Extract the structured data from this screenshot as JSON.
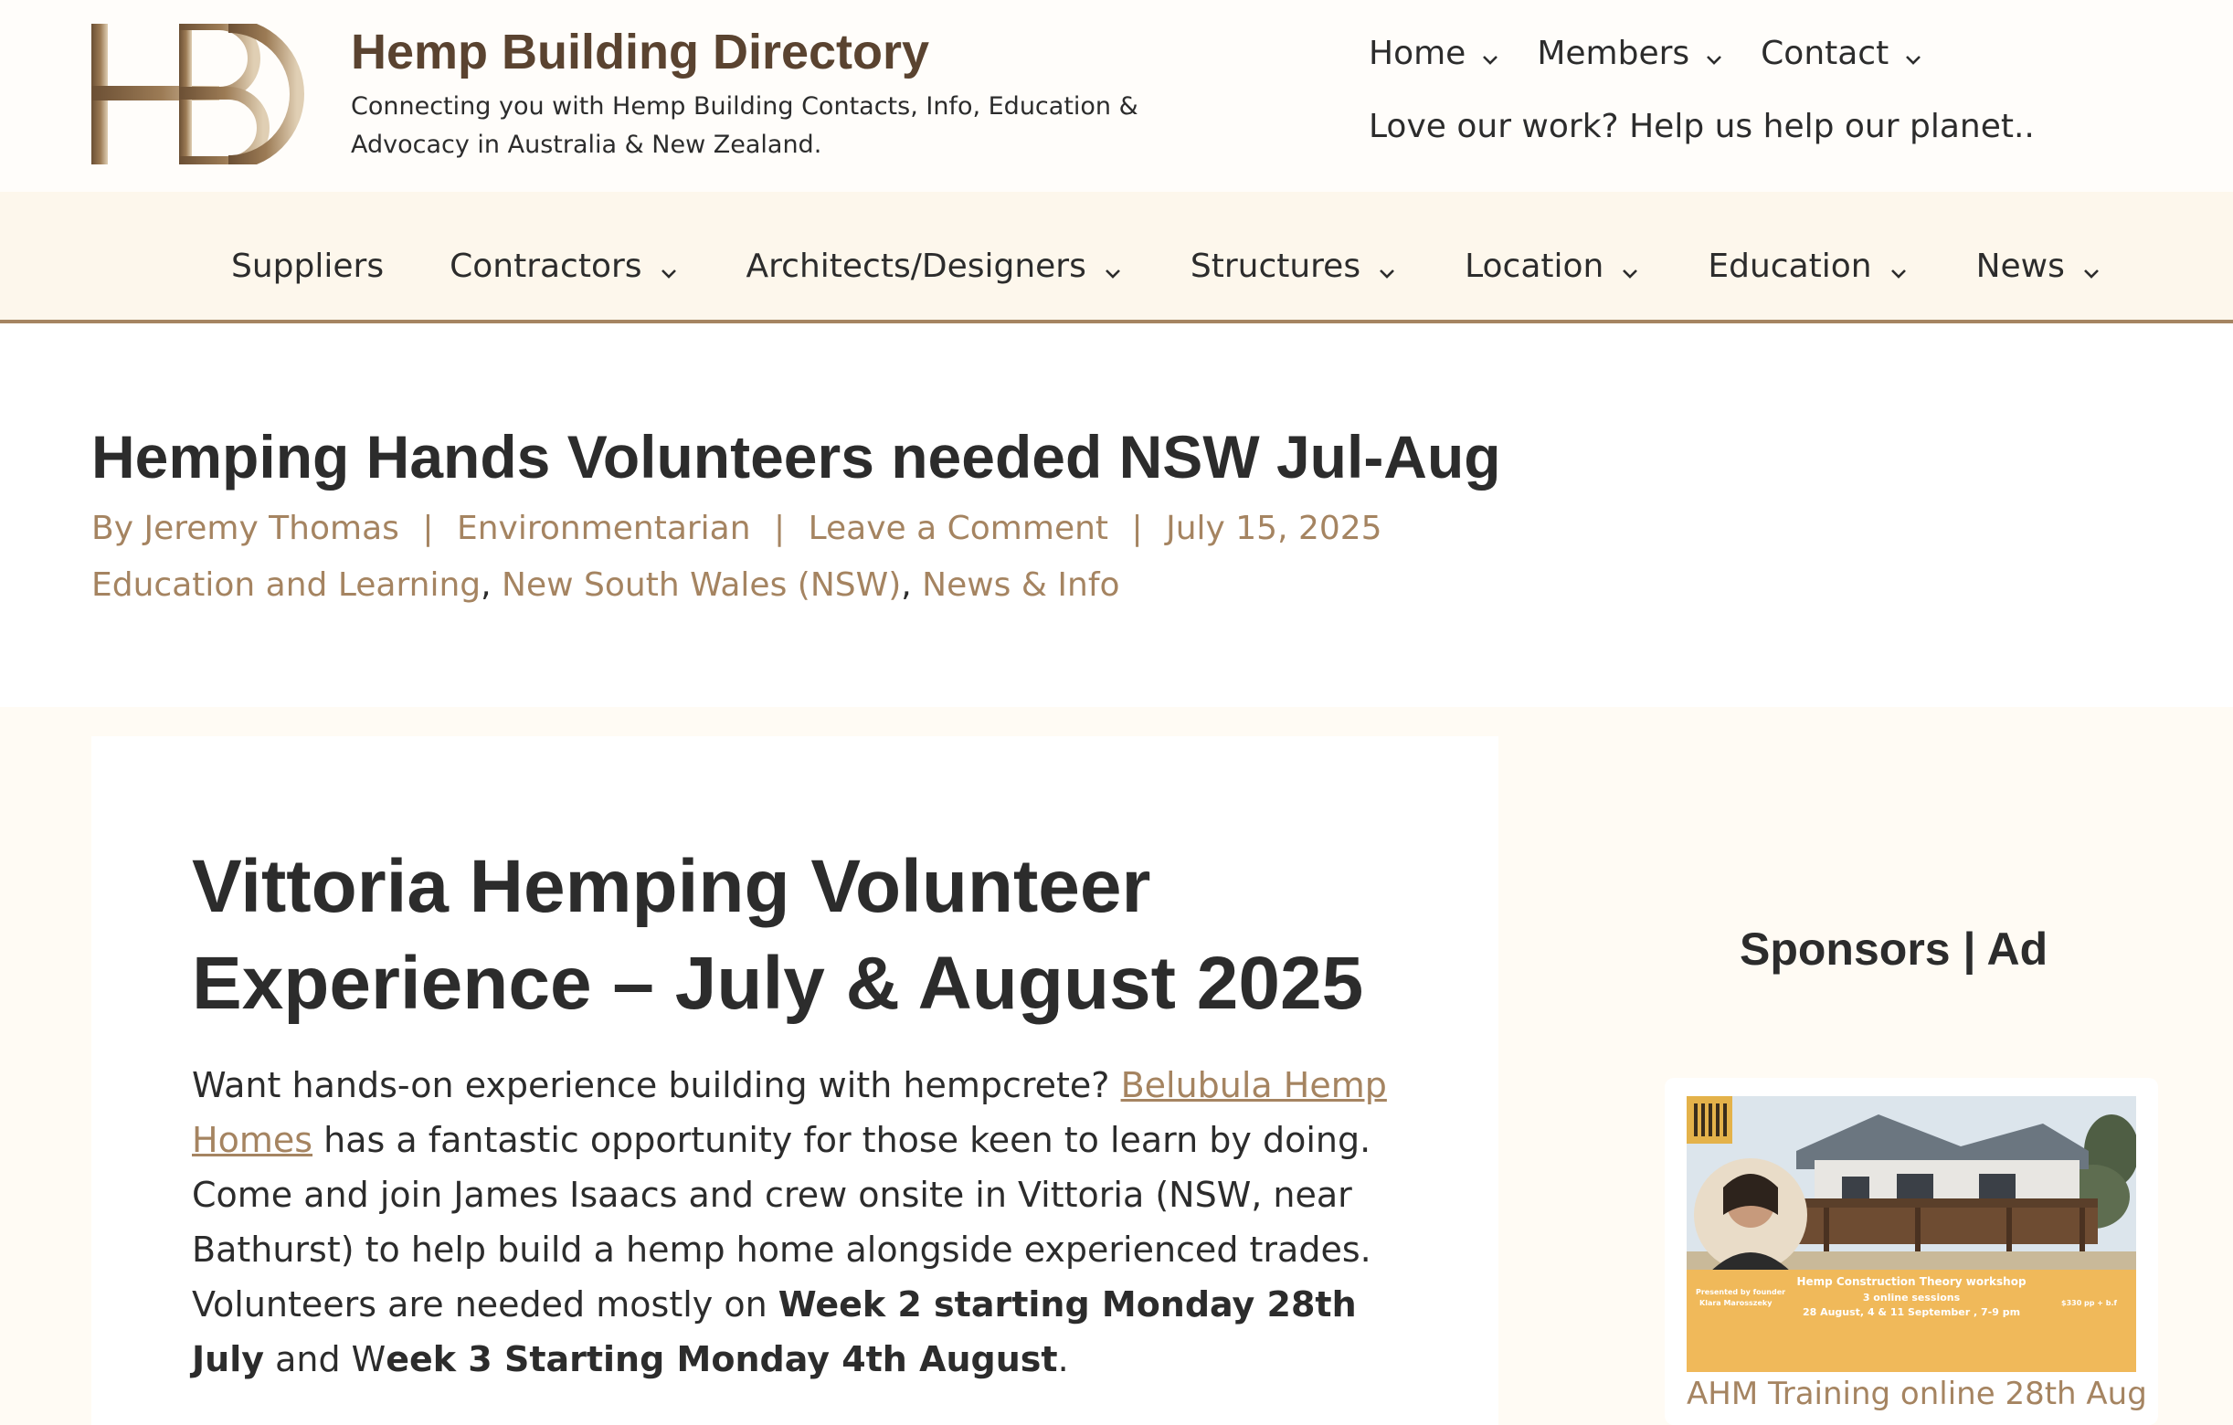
{
  "site": {
    "title": "Hemp Building Directory",
    "tagline": "Connecting you with Hemp Building Contacts, Info, Education & Advocacy in Australia & New Zealand.",
    "logo_text": "HBD"
  },
  "top_nav": {
    "items": [
      {
        "label": "Home"
      },
      {
        "label": "Members"
      },
      {
        "label": "Contact"
      }
    ],
    "support_text": "Love our work? Help us help our planet.."
  },
  "main_nav": {
    "items": [
      {
        "label": "Suppliers"
      },
      {
        "label": "Contractors"
      },
      {
        "label": "Architects/Designers"
      },
      {
        "label": "Structures"
      },
      {
        "label": "Location"
      },
      {
        "label": "Education"
      },
      {
        "label": "News"
      }
    ]
  },
  "post": {
    "title": "Hemping Hands Volunteers needed NSW Jul-Aug",
    "author": "By Jeremy Thomas",
    "author_role": "Environmentarian",
    "comment_link": "Leave a Comment",
    "date": "July 15, 2025",
    "separator": "|",
    "categories": [
      "Education and Learning",
      "New South Wales (NSW)",
      "News & Info"
    ],
    "category_sep": ","
  },
  "article": {
    "heading": "Vittoria Hemping Volunteer Experience – July & August 2025",
    "p1_before": "Want hands-on experience building with hempcrete? ",
    "p1_link": "Belubula Hemp Homes",
    "p1_after": " has a fantastic opportunity for those keen to learn by doing. Come and join James Isaacs and crew onsite in Vittoria (NSW, near Bathurst) to help build a hemp home alongside experienced trades. Volunteers are needed mostly on ",
    "p1_bold1": "Week 2 starting Monday 28th July",
    "p1_mid": " and W",
    "p1_bold2": "eek 3 Starting Monday 4th August",
    "p1_end": "."
  },
  "sidebar": {
    "title": "Sponsors | Ad",
    "ad": {
      "caption": "AHM Training online 28th Aug",
      "banner_text": "Hemp Construction Theory workshop",
      "banner_sub1": "3 online sessions",
      "banner_sub2": "28 August, 4 & 11 September , 7-9 pm",
      "presented": "Presented by founder",
      "presenter": "Klara Marosszeky",
      "price": "$330 pp + b.f"
    }
  },
  "colors": {
    "brand_brown": "#5a4330",
    "accent": "#a58461",
    "nav_bg": "#fdf7ec",
    "ad_banner": "#f0b95a"
  }
}
